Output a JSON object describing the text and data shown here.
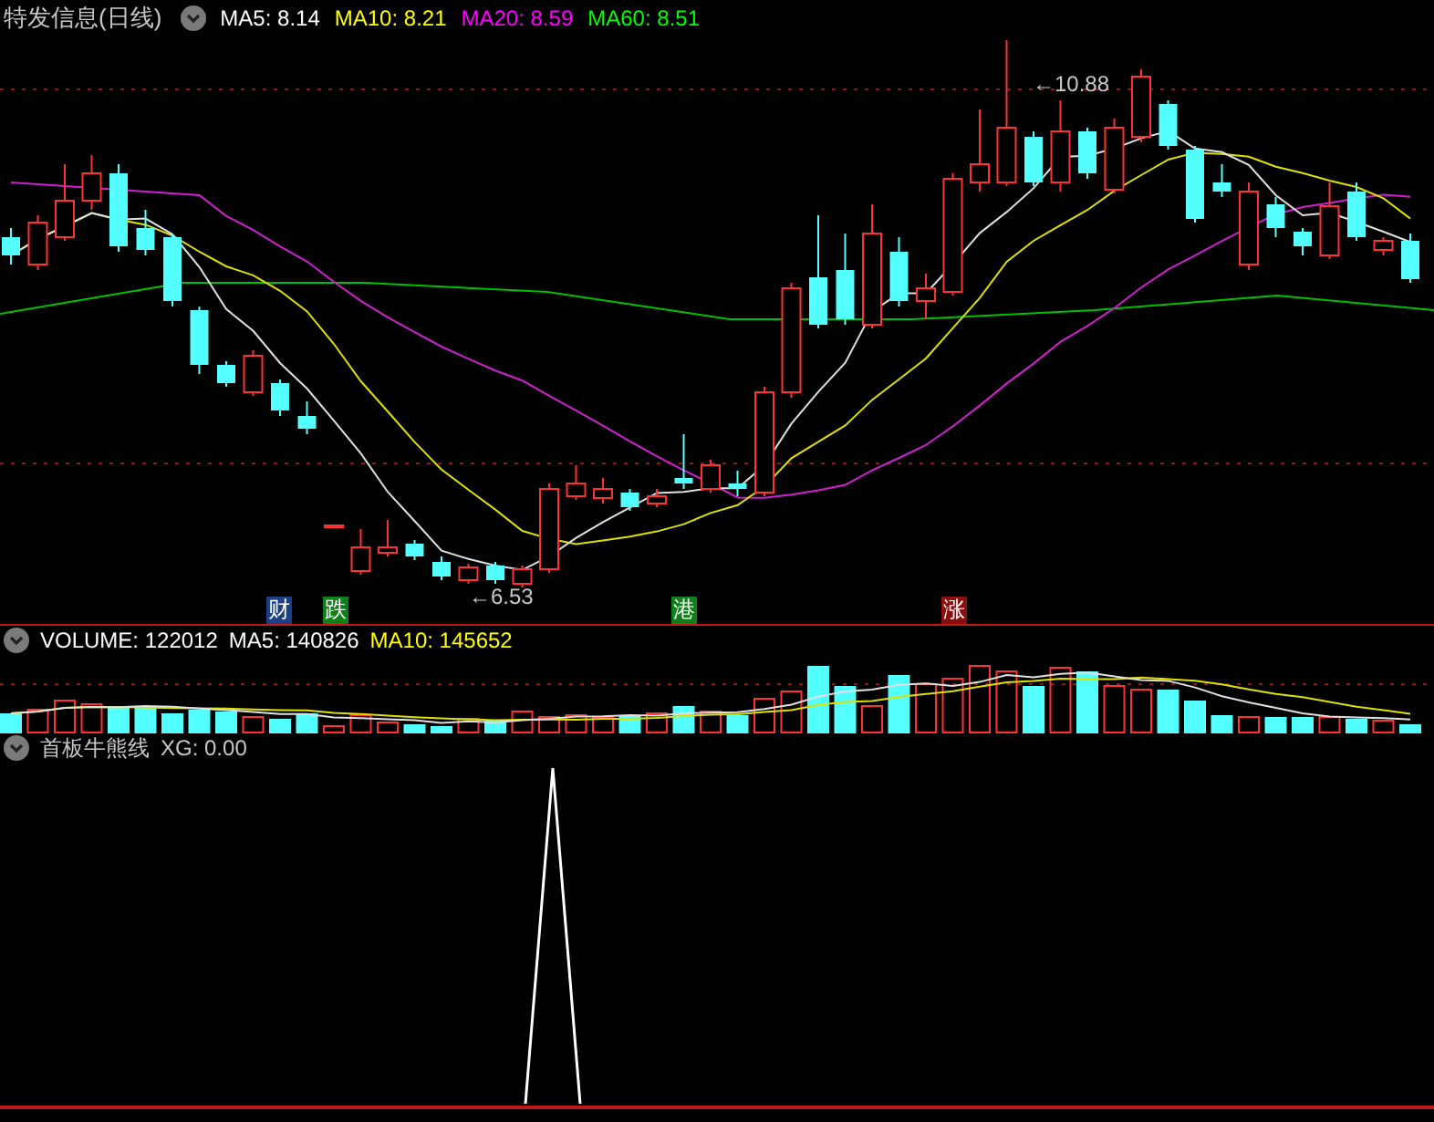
{
  "title": "特发信息(日线)",
  "ma_legend": [
    {
      "text": "MA5: 8.14",
      "color": "#ffffff"
    },
    {
      "text": "MA10: 8.21",
      "color": "#ffff00"
    },
    {
      "text": "MA20: 8.59",
      "color": "#ff00ff"
    },
    {
      "text": "MA60: 8.51",
      "color": "#00ff00"
    }
  ],
  "price_annotations": [
    {
      "text": "←10.88"
    },
    {
      "text": "←6.53"
    }
  ],
  "event_markers": [
    {
      "text": "财",
      "color": "#1c3f86"
    },
    {
      "text": "跌",
      "color": "#12801a"
    },
    {
      "text": "港",
      "color": "#12801a"
    },
    {
      "text": "涨",
      "color": "#8a1010"
    }
  ],
  "volume_legend": [
    {
      "text": "VOLUME: 122012",
      "color": "#ffffff"
    },
    {
      "text": "MA5: 140826",
      "color": "#ffffff"
    },
    {
      "text": "MA10: 145652",
      "color": "#ffff00"
    }
  ],
  "indicator_legend": {
    "name": "首板牛熊线",
    "value": "XG: 0.00"
  }
}
